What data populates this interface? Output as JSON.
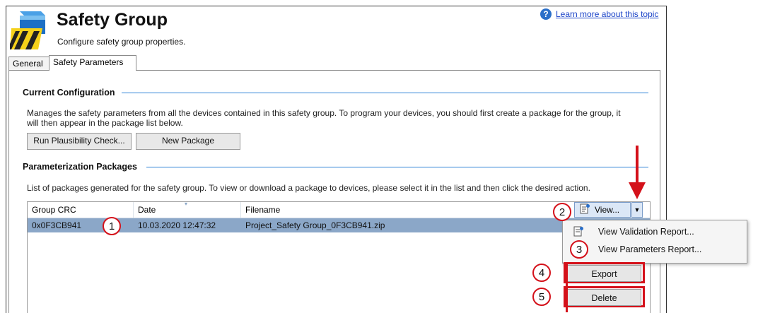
{
  "header": {
    "title": "Safety Group",
    "subtitle": "Configure safety group properties.",
    "help_link": "Learn more about this topic"
  },
  "tabs": [
    {
      "label": "General",
      "active": false
    },
    {
      "label": "Safety Parameters",
      "active": true
    }
  ],
  "current_configuration": {
    "title": "Current Configuration",
    "description_line1": "Manages the safety parameters from all the devices contained in this safety group.  To program your devices, you should first create a package for the group, it",
    "description_line2": "will then appear in the package list below.",
    "run_check_button": "Run Plausibility Check...",
    "new_package_button": "New Package"
  },
  "packages": {
    "title": "Parameterization Packages",
    "description": "List of packages generated for the safety group.  To view or download a package to devices, please select it in the list and then click the desired action.",
    "columns": [
      "Group CRC",
      "Date",
      "Filename"
    ],
    "rows": [
      {
        "crc": "0x0F3CB941",
        "date": "10.03.2020 12:47:32",
        "filename": "Project_Safety Group_0F3CB941.zip"
      }
    ]
  },
  "actions": {
    "view_button": "View...",
    "menu": [
      "View Validation Report...",
      "View Parameters Report..."
    ],
    "export_button": "Export",
    "delete_button": "Delete"
  },
  "callouts": [
    "1",
    "2",
    "3",
    "4",
    "5"
  ],
  "colors": {
    "accent_red": "#d4111a",
    "section_rule": "#2f83d6",
    "selected_row": "#8ba7c8",
    "link": "#1a43c8"
  },
  "icons": {
    "logo": "safety-group-logo-icon",
    "help": "help-question-icon",
    "report": "report-document-icon",
    "dropdown": "dropdown-arrow-icon"
  }
}
